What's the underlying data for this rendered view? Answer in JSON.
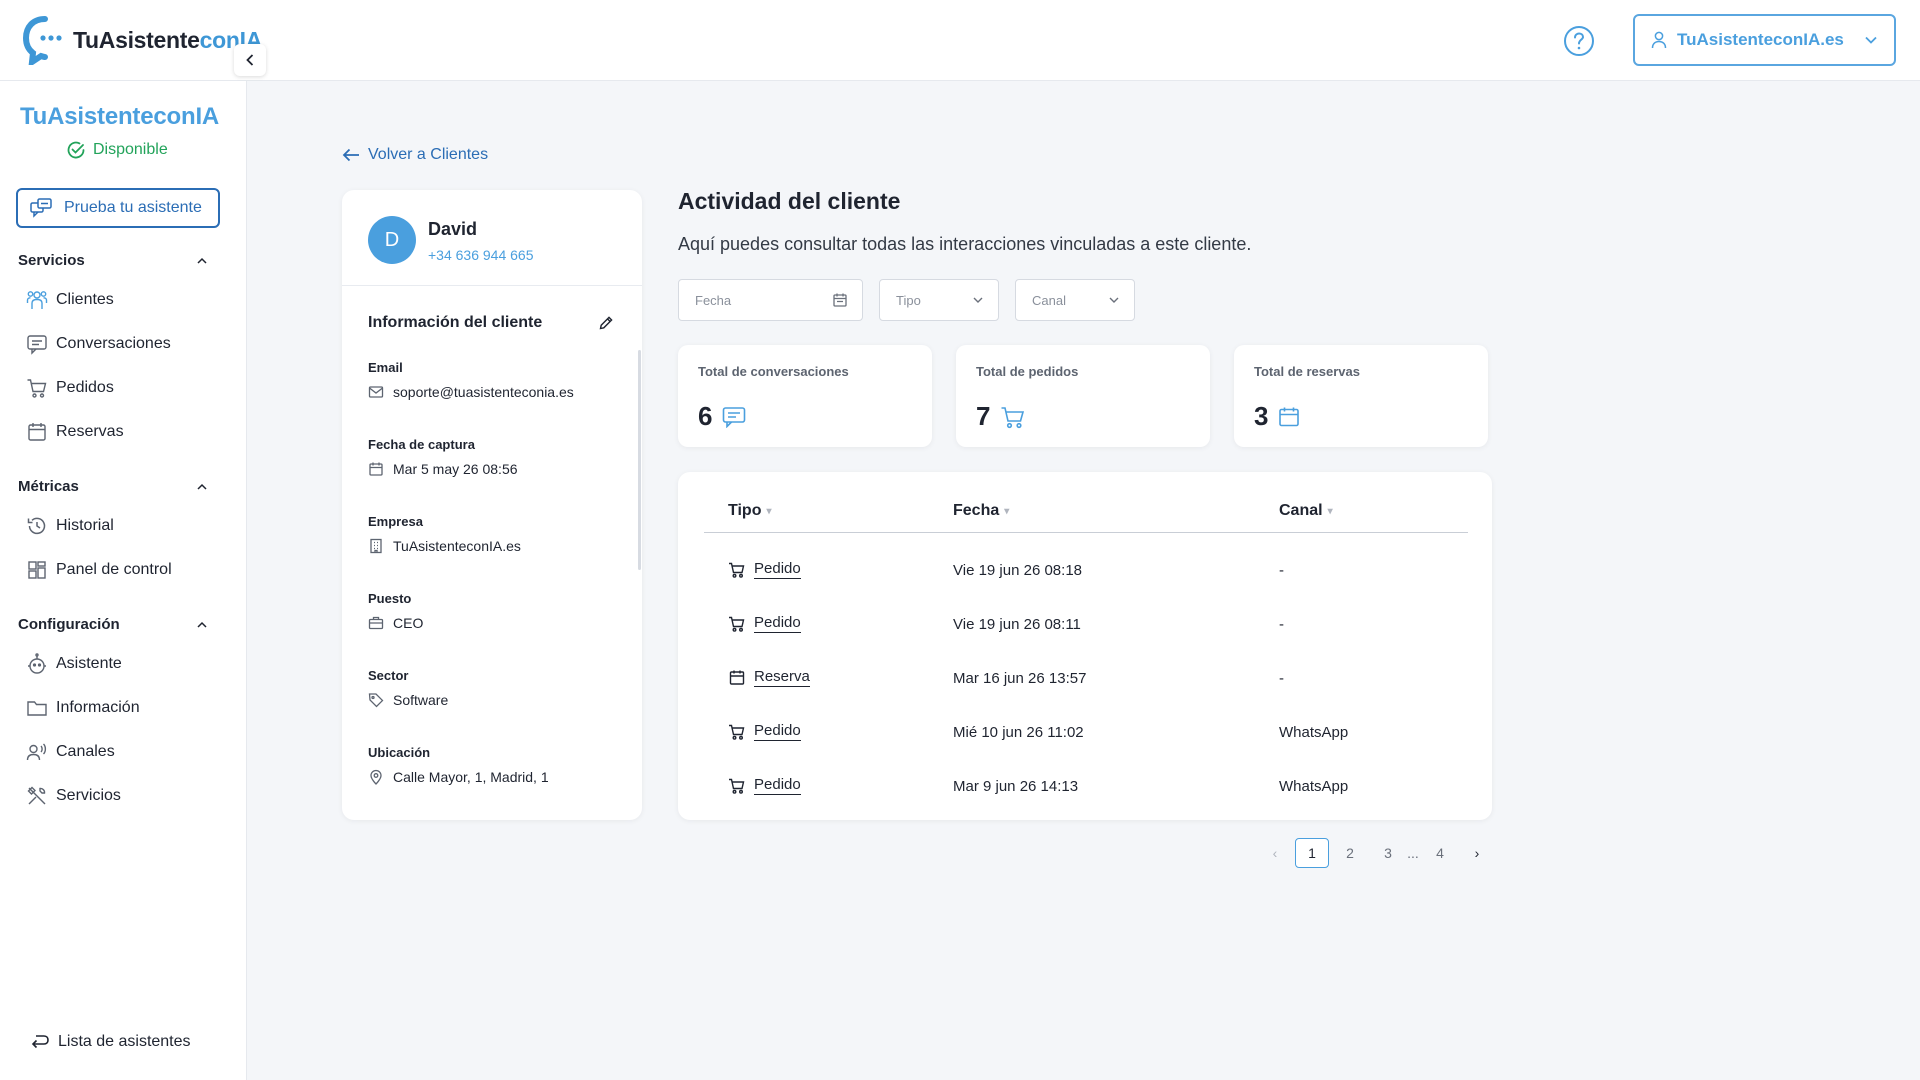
{
  "header": {
    "brand_dark": "TuAsistente",
    "brand_blue": "conIA",
    "account_label": "TuAsistenteconIA.es",
    "colors": {
      "brand": "#4a9fde",
      "link": "#2b6db5",
      "success": "#22a35a"
    }
  },
  "sidebar": {
    "title": "TuAsistenteconIA",
    "status": "Disponible",
    "try_button": "Prueba tu asistente",
    "sections": [
      {
        "label": "Servicios",
        "items": [
          "Clientes",
          "Conversaciones",
          "Pedidos",
          "Reservas"
        ]
      },
      {
        "label": "Métricas",
        "items": [
          "Historial",
          "Panel de control"
        ]
      },
      {
        "label": "Configuración",
        "items": [
          "Asistente",
          "Información",
          "Canales",
          "Servicios"
        ]
      }
    ],
    "bottom_link": "Lista de asistentes"
  },
  "main": {
    "back_link": "Volver a Clientes",
    "client": {
      "initial": "D",
      "name": "David",
      "phone": "+34 636 944 665",
      "info_title": "Información del cliente",
      "fields": [
        {
          "label": "Email",
          "value": "soporte@tuasistenteconia.es",
          "icon": "mail-icon"
        },
        {
          "label": "Fecha de captura",
          "value": "Mar 5 may 26 08:56",
          "icon": "calendar-icon"
        },
        {
          "label": "Empresa",
          "value": "TuAsistenteconIA.es",
          "icon": "building-icon"
        },
        {
          "label": "Puesto",
          "value": "CEO",
          "icon": "briefcase-icon"
        },
        {
          "label": "Sector",
          "value": "Software",
          "icon": "tag-icon"
        },
        {
          "label": "Ubicación",
          "value": "Calle Mayor, 1, Madrid, 1",
          "icon": "location-pin-icon"
        }
      ]
    },
    "activity": {
      "title": "Actividad del cliente",
      "subtitle": "Aquí puedes consultar todas las interacciones vinculadas a este cliente.",
      "filters": {
        "date_placeholder": "Fecha",
        "type_placeholder": "Tipo",
        "channel_placeholder": "Canal"
      },
      "stats": [
        {
          "label": "Total de conversaciones",
          "value": "6",
          "icon": "chat-icon"
        },
        {
          "label": "Total de pedidos",
          "value": "7",
          "icon": "cart-icon"
        },
        {
          "label": "Total de reservas",
          "value": "3",
          "icon": "calendar-icon"
        }
      ],
      "table": {
        "columns": [
          "Tipo",
          "Fecha",
          "Canal"
        ],
        "rows": [
          {
            "type": "Pedido",
            "icon": "cart-icon",
            "date": "Vie 19 jun 26 08:18",
            "channel": "-"
          },
          {
            "type": "Pedido",
            "icon": "cart-icon",
            "date": "Vie 19 jun 26 08:11",
            "channel": "-"
          },
          {
            "type": "Reserva",
            "icon": "calendar-icon",
            "date": "Mar 16 jun 26 13:57",
            "channel": "-"
          },
          {
            "type": "Pedido",
            "icon": "cart-icon",
            "date": "Mié 10 jun 26 11:02",
            "channel": "WhatsApp"
          },
          {
            "type": "Pedido",
            "icon": "cart-icon",
            "date": "Mar 9 jun 26 14:13",
            "channel": "WhatsApp"
          }
        ]
      },
      "pagination": {
        "prev": "‹",
        "pages": [
          "1",
          "2",
          "3",
          "4"
        ],
        "ellipsis": "...",
        "next": "›",
        "current": "1"
      }
    }
  }
}
